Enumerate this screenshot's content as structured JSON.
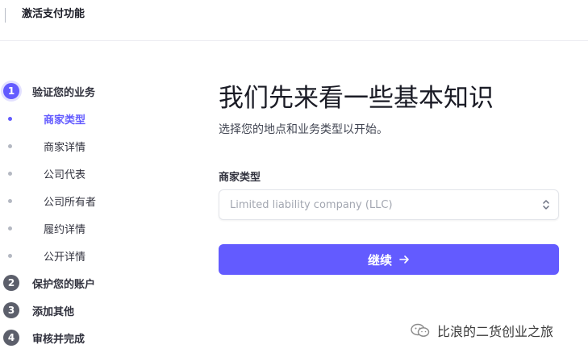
{
  "topbar": {
    "title": "激活支付功能"
  },
  "sidebar": {
    "steps": [
      {
        "number": "1",
        "label": "验证您的业务",
        "active": true
      },
      {
        "number": "2",
        "label": "保护您的账户",
        "active": false
      },
      {
        "number": "3",
        "label": "添加其他",
        "active": false
      },
      {
        "number": "4",
        "label": "审核并完成",
        "active": false
      }
    ],
    "substeps": [
      {
        "label": "商家类型",
        "active": true
      },
      {
        "label": "商家详情",
        "active": false
      },
      {
        "label": "公司代表",
        "active": false
      },
      {
        "label": "公司所有者",
        "active": false
      },
      {
        "label": "履约详情",
        "active": false
      },
      {
        "label": "公开详情",
        "active": false
      }
    ]
  },
  "main": {
    "heading": "我们先来看一些基本知识",
    "subheading": "选择您的地点和业务类型以开始。",
    "business_type_label": "商家类型",
    "business_type_value": "Limited liability company (LLC)",
    "continue_label": "继续"
  },
  "watermark": {
    "text": "比浪的二货创业之旅"
  },
  "colors": {
    "accent": "#635bff",
    "text": "#30313d",
    "muted": "#a3a7b1"
  }
}
